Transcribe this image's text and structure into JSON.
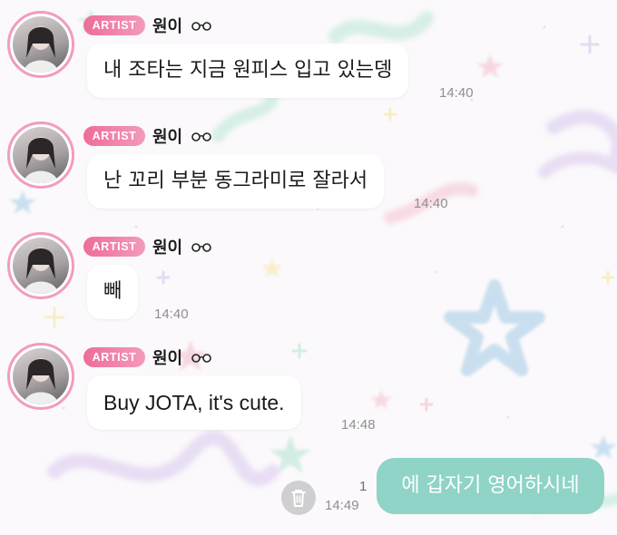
{
  "theme": {
    "badge_color": "#ee6d99",
    "avatar_ring_color": "#f29bc0",
    "my_bubble_color": "#8fd4c6",
    "incoming_bubble_color": "#ffffff"
  },
  "messages": [
    {
      "sender_badge": "ARTIST",
      "sender_name": "원이",
      "sender_emoji_icon": "glasses-icon",
      "text": "내 조타는 지금 원피스 입고 있는뎅",
      "time": "14:40"
    },
    {
      "sender_badge": "ARTIST",
      "sender_name": "원이",
      "sender_emoji_icon": "glasses-icon",
      "text": "난 꼬리 부분 동그라미로 잘라서",
      "time": "14:40"
    },
    {
      "sender_badge": "ARTIST",
      "sender_name": "원이",
      "sender_emoji_icon": "glasses-icon",
      "text": "빼",
      "time": "14:40"
    },
    {
      "sender_badge": "ARTIST",
      "sender_name": "원이",
      "sender_emoji_icon": "glasses-icon",
      "text": "Buy JOTA, it's cute.",
      "time": "14:48"
    }
  ],
  "my_message": {
    "text": "에 갑자기 영어하시네",
    "time": "14:49",
    "unread_count": "1",
    "delete_icon": "trash-icon"
  }
}
